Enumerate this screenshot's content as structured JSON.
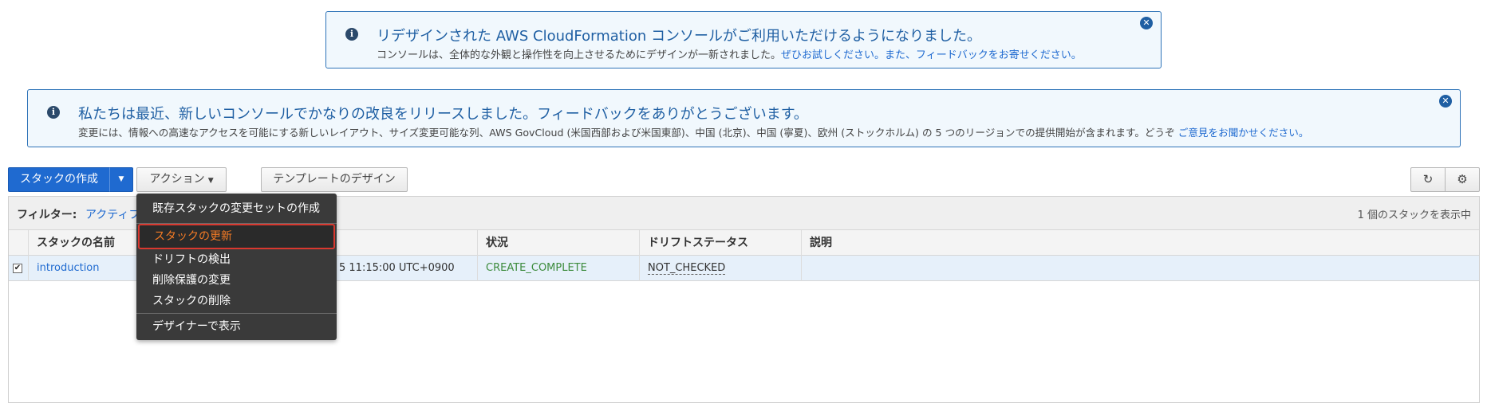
{
  "notice1": {
    "title": "リデザインされた AWS CloudFormation コンソールがご利用いただけるようになりました。",
    "body": "コンソールは、全体的な外観と操作性を向上させるためにデザインが一新されました。",
    "link": "ぜひお試しください。また、フィードバックをお寄せください。"
  },
  "notice2": {
    "title": "私たちは最近、新しいコンソールでかなりの改良をリリースしました。フィードバックをありがとうございます。",
    "body": "変更には、情報への高速なアクセスを可能にする新しいレイアウト、サイズ変更可能な列、AWS GovCloud (米国西部および米国東部)、中国 (北京)、中国 (寧夏)、欧州 (ストックホルム) の 5 つのリージョンでの提供開始が含まれます。どうぞ",
    "link": "ご意見をお聞かせください。"
  },
  "toolbar": {
    "create": "スタックの作成",
    "actions": "アクション",
    "template": "テンプレートのデザイン"
  },
  "filter": {
    "label": "フィルター:",
    "value": "アクティブ",
    "count": "1 個のスタックを表示中"
  },
  "table": {
    "headers": [
      "スタックの名前",
      "状況",
      "ドリフトステータス",
      "説明"
    ],
    "row": {
      "name": "introduction",
      "created": "5 11:15:00 UTC+0900",
      "status": "CREATE_COMPLETE",
      "drift": "NOT_CHECKED",
      "description": ""
    }
  },
  "menu": {
    "items": [
      "既存スタックの変更セットの作成",
      "スタックの更新",
      "ドリフトの検出",
      "削除保護の変更",
      "スタックの削除",
      "デザイナーで表示"
    ]
  },
  "icons": {
    "info": "i",
    "close": "✕",
    "caret": "▼",
    "refresh": "↻",
    "settings": "⚙",
    "check": "✔"
  },
  "colors": {
    "primary": "#1f6ad0",
    "status_ok": "#3c8b3c",
    "highlight": "#f47b25"
  }
}
